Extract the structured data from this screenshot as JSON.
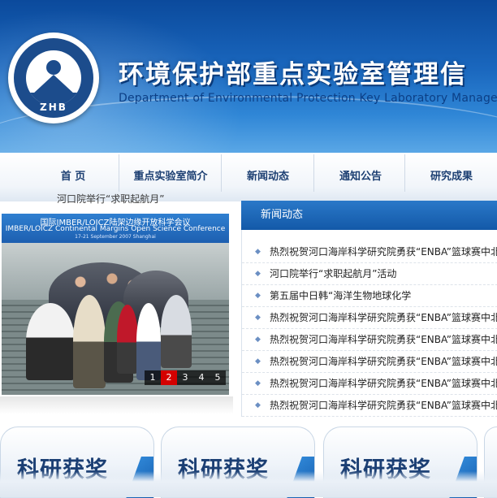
{
  "header": {
    "logo_abbr": "ZHB",
    "title": "环境保护部重点实验室管理信",
    "subtitle": "Department of Environmental Protection Key Laboratory Manageme"
  },
  "nav": {
    "items": [
      {
        "label": "首 页"
      },
      {
        "label": "重点实验室简介"
      },
      {
        "label": "新闻动态"
      },
      {
        "label": "通知公告"
      },
      {
        "label": "研究成果"
      }
    ]
  },
  "photo": {
    "caption": "河口院举行“求职起航月”",
    "banner_line1": "国际IMBER/LOICZ陆架边缘开放科学会议",
    "banner_line2": "IMBER/LOICZ Continental Margins Open Science Conference",
    "banner_line3": "17-21 September 2007 Shanghai",
    "pages": [
      "1",
      "2",
      "3",
      "4",
      "5"
    ],
    "active_page": "2"
  },
  "news": {
    "title": "新闻动态",
    "bullet": "◆",
    "items": [
      {
        "text": "热烈祝贺河口海岸科学研究院勇获“ENBA”篮球赛中北"
      },
      {
        "text": "河口院举行“求职起航月”活动"
      },
      {
        "text": "第五届中日韩“海洋生物地球化学"
      },
      {
        "text": "热烈祝贺河口海岸科学研究院勇获“ENBA”篮球赛中北"
      },
      {
        "text": "热烈祝贺河口海岸科学研究院勇获“ENBA”篮球赛中北"
      },
      {
        "text": "热烈祝贺河口海岸科学研究院勇获“ENBA”篮球赛中北"
      },
      {
        "text": "热烈祝贺河口海岸科学研究院勇获“ENBA”篮球赛中北"
      },
      {
        "text": "热烈祝贺河口海岸科学研究院勇获“ENBA”篮球赛中北"
      }
    ]
  },
  "tiles": [
    {
      "label": "科研获奖"
    },
    {
      "label": "科研获奖"
    },
    {
      "label": "科研获奖"
    }
  ],
  "colors": {
    "banner": "#1a67be",
    "nav_text": "#1c3f72",
    "news_header": "#1359a8",
    "pager_active": "#d40000"
  }
}
